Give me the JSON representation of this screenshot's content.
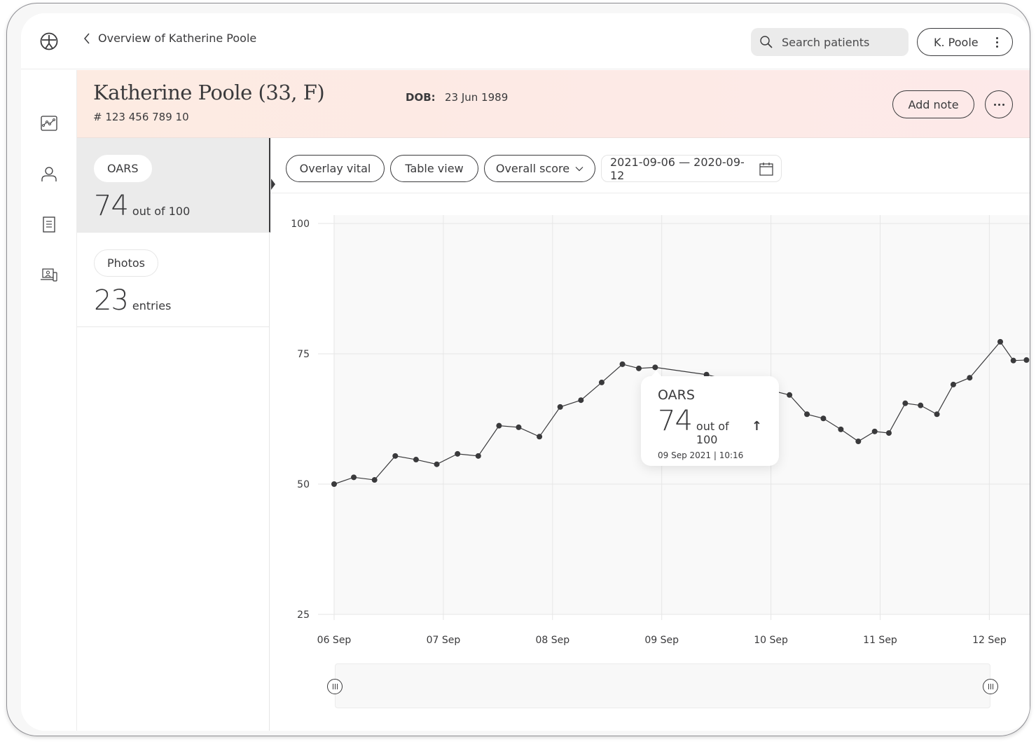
{
  "topbar": {
    "back_label": "Overview of Katherine Poole",
    "search_placeholder": "Search patients",
    "user_label": "K. Poole"
  },
  "rail": {
    "items": [
      {
        "icon": "chart-icon",
        "label": "Vitals"
      },
      {
        "icon": "person-icon",
        "label": "Profile"
      },
      {
        "icon": "document-icon",
        "label": "Notes"
      },
      {
        "icon": "telehealth-icon",
        "label": "Devices"
      }
    ]
  },
  "patient": {
    "name": "Katherine Poole (33,  F)",
    "id": "# 123 456 789 10",
    "dob_label": "DOB:",
    "dob": "23 Jun 1989",
    "add_note_label": "Add note"
  },
  "colors": {
    "accent": "#3a3a3c",
    "header_bg": "#fdebe2",
    "active_vital_bg": "#ebebeb"
  },
  "vitals": [
    {
      "name": "OARS",
      "value": "74",
      "unit": "out of 100",
      "active": true
    },
    {
      "name": "Photos",
      "value": "23",
      "unit": "entries",
      "active": false
    }
  ],
  "toolbar": {
    "overlay_label": "Overlay vital",
    "table_label": "Table view",
    "score_select": "Overall score",
    "date_range": "2021-09-06 — 2020-09-12"
  },
  "tooltip": {
    "title": "OARS",
    "value": "74",
    "unit": "out of 100",
    "trend": "↑",
    "timestamp": "09 Sep 2021 | 10:16"
  },
  "chart_data": {
    "type": "line",
    "title": "OARS",
    "xlabel": "",
    "ylabel": "",
    "ylim": [
      25,
      100
    ],
    "yticks": [
      100,
      75,
      50,
      25
    ],
    "xticks": [
      "06 Sep",
      "07 Sep",
      "08 Sep",
      "09 Sep",
      "10 Sep",
      "11 Sep",
      "12 Sep"
    ],
    "xlim_days": [
      0,
      6.35
    ],
    "grid": true,
    "series": [
      {
        "name": "OARS",
        "x_days": [
          0,
          0.18,
          0.37,
          0.56,
          0.75,
          0.94,
          1.13,
          1.32,
          1.51,
          1.69,
          1.88,
          2.07,
          2.26,
          2.45,
          2.64,
          2.79,
          2.94,
          3.41,
          4.17,
          4.33,
          4.48,
          4.64,
          4.8,
          4.95,
          5.08,
          5.23,
          5.37,
          5.52,
          5.67,
          5.82,
          6.1,
          6.22,
          6.34
        ],
        "values": [
          50.0,
          51.3,
          50.8,
          55.4,
          54.7,
          53.8,
          55.8,
          55.4,
          61.2,
          60.9,
          59.1,
          64.8,
          66.1,
          69.5,
          73.0,
          72.2,
          72.4,
          71.0,
          67.1,
          63.4,
          62.6,
          60.5,
          58.2,
          60.1,
          59.8,
          65.5,
          65.1,
          63.4,
          69.1,
          70.4,
          77.3,
          73.7,
          73.8
        ]
      }
    ],
    "range_selector": {
      "start": "06 Sep",
      "end": "12 Sep"
    }
  }
}
